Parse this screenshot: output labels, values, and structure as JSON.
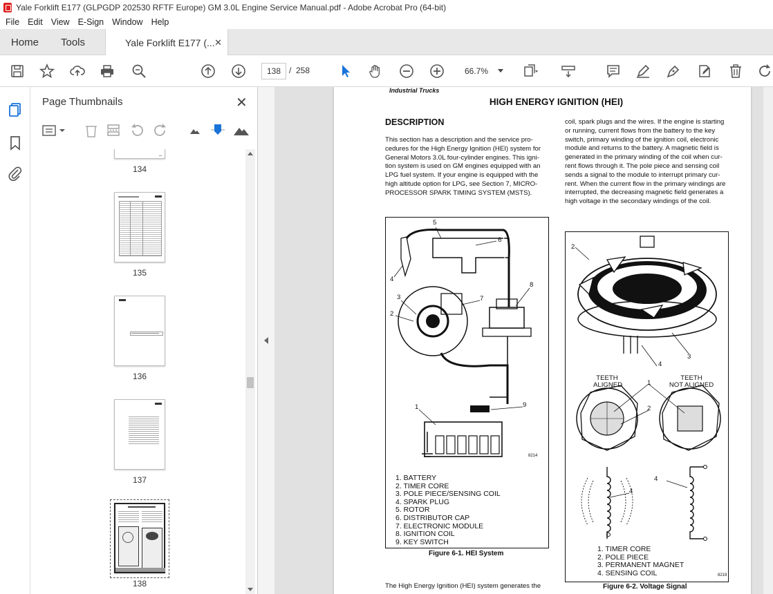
{
  "window": {
    "title": "Yale Forklift E177 (GLPGDP 202530 RFTF Europe) GM 3.0L Engine Service Manual.pdf - Adobe Acrobat Pro (64-bit)"
  },
  "menu": [
    "File",
    "Edit",
    "View",
    "E-Sign",
    "Window",
    "Help"
  ],
  "tabs": {
    "home": "Home",
    "tools": "Tools",
    "document": "Yale Forklift E177 (..."
  },
  "toolbar": {
    "current_page": "138",
    "separator": "/",
    "total_pages": "258",
    "zoom": "66.7%"
  },
  "panel": {
    "title": "Page Thumbnails",
    "thumbnails": [
      {
        "label": "134"
      },
      {
        "label": "135"
      },
      {
        "label": "136"
      },
      {
        "label": "137"
      },
      {
        "label": "138",
        "selected": true
      }
    ]
  },
  "page": {
    "header_brand": "Industrial Trucks",
    "title": "HIGH ENERGY IGNITION (HEI)",
    "section_heading": "DESCRIPTION",
    "description_lines": [
      "This section has a description and the service pro-",
      "cedures for the High Energy Ignition (HEI) system for",
      "General Motors 3.0L four-cylinder engines. This igni-",
      "tion system is used on GM engines equipped with an",
      "LPG fuel system. If your engine is equipped with the",
      "high altitude option for LPG, see Section 7, MICRO-",
      "PROCESSOR SPARK TIMING SYSTEM (MSTS)."
    ],
    "right_column_lines": [
      "coil, spark plugs and the wires. If the engine is starting",
      "or running, current flows from the battery to the key",
      "switch, primary winding of the ignition coil, electronic",
      "module and returns to the battery. A magnetic field is",
      "generated in the primary winding of the coil when cur-",
      "rent flows through it. The pole piece and sensing coil",
      "sends a signal to the module to interrupt primary cur-",
      "rent. When the current flow in the primary windings are",
      "interrupted, the decreasing magnetic field generates a",
      "high voltage in the secondary windings of the coil."
    ],
    "figure1": {
      "code": "8214",
      "caption": "Figure 6-1. HEI System",
      "callouts": [
        "5",
        "6",
        "4",
        "8",
        "3",
        "7",
        "2",
        "1",
        "9"
      ],
      "legend": [
        "1.  BATTERY",
        "2.  TIMER CORE",
        "3.  POLE PIECE/SENSING COIL",
        "4.  SPARK PLUG",
        "5.  ROTOR",
        "6.  DISTRIBUTOR CAP",
        "7.  ELECTRONIC MODULE",
        "8.  IGNITION COIL",
        "9.  KEY SWITCH"
      ]
    },
    "figure2": {
      "code": "8219",
      "caption": "Figure 6-2. Voltage Signal",
      "teeth_aligned": "TEETH\nALIGNED",
      "teeth_not_aligned": "TEETH\nNOT ALIGNED",
      "callouts": [
        "2",
        "4",
        "3",
        "1",
        "2",
        "4",
        "4"
      ],
      "legend": [
        "1.  TIMER CORE",
        "2.  POLE PIECE",
        "3.  PERMANENT MAGNET",
        "4.  SENSING COIL"
      ]
    },
    "bottom_text": "The High Energy Ignition (HEI) system generates the"
  }
}
